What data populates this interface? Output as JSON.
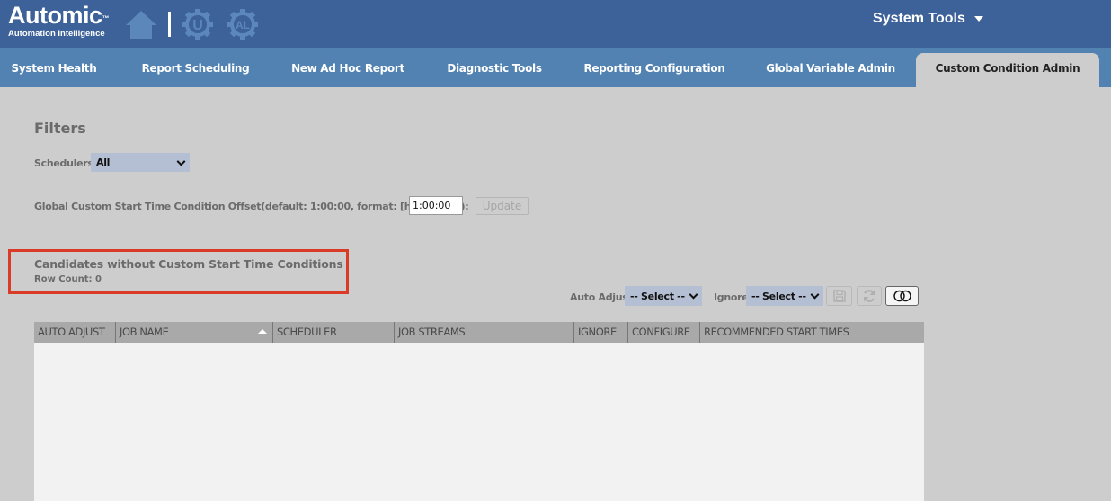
{
  "header": {
    "logo_text": "Automic",
    "logo_tm": "™",
    "logo_subtitle": "Automation Intelligence",
    "icons": [
      "home-icon",
      "u-gear-icon",
      "al-gear-icon"
    ],
    "menu_label": "System Tools",
    "colors": {
      "topbar": "#3d6199",
      "tabbar": "#5182b2",
      "icon_muted": "#5b87bb"
    }
  },
  "tabs": [
    {
      "label": "System Health",
      "active": false
    },
    {
      "label": "Report Scheduling",
      "active": false
    },
    {
      "label": "New Ad Hoc Report",
      "active": false
    },
    {
      "label": "Diagnostic Tools",
      "active": false
    },
    {
      "label": "Reporting Configuration",
      "active": false
    },
    {
      "label": "Global Variable Admin",
      "active": false
    },
    {
      "label": "Custom Condition Admin",
      "active": true
    }
  ],
  "filters": {
    "title": "Filters",
    "schedulers_label": "Schedulers:",
    "schedulers_value": "All",
    "offset_label": "Global Custom Start Time Condition Offset(default: 1:00:00, format: [h]h:mm:ss):",
    "offset_value": "1:00:00",
    "update_label": "Update"
  },
  "candidates": {
    "title": "Candidates without Custom Start Time Conditions",
    "row_count_label": "Row Count: 0",
    "highlight_color": "#d93b27",
    "toolbar": {
      "auto_adjust_label": "Auto Adjust",
      "auto_adjust_value": "-- Select --",
      "ignore_label": "Ignore",
      "ignore_value": "-- Select --",
      "buttons": [
        "save-icon",
        "refresh-icon",
        "toggle-icon"
      ]
    },
    "table": {
      "columns": [
        {
          "label": "AUTO ADJUST",
          "sorted": ""
        },
        {
          "label": "JOB NAME",
          "sorted": "asc"
        },
        {
          "label": "SCHEDULER",
          "sorted": ""
        },
        {
          "label": "JOB STREAMS",
          "sorted": ""
        },
        {
          "label": "IGNORE",
          "sorted": ""
        },
        {
          "label": "CONFIGURE",
          "sorted": ""
        },
        {
          "label": "RECOMMENDED START TIMES",
          "sorted": ""
        }
      ],
      "rows": []
    }
  }
}
